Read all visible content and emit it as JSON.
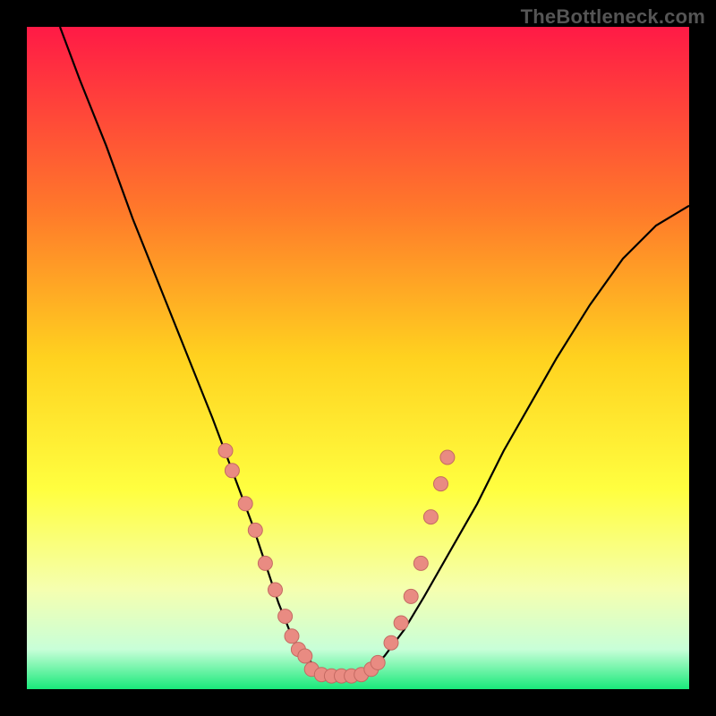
{
  "watermark": "TheBottleneck.com",
  "colors": {
    "bg_black": "#000000",
    "grad_top": "#ff1a46",
    "grad_mid1": "#ff7a2a",
    "grad_mid2": "#ffd21f",
    "grad_mid3": "#ffff40",
    "grad_mid4": "#f5ffb0",
    "grad_bottom_pale": "#c8ffd8",
    "grad_bottom": "#19e97a",
    "curve": "#000000",
    "dot_fill": "#e98b82",
    "dot_stroke": "#c46a62"
  },
  "chart_data": {
    "type": "line",
    "title": "",
    "xlabel": "",
    "ylabel": "",
    "xlim": [
      0,
      100
    ],
    "ylim": [
      0,
      100
    ],
    "series": [
      {
        "name": "curve",
        "x": [
          5,
          8,
          12,
          16,
          20,
          24,
          28,
          31,
          34,
          36,
          38,
          40,
          42,
          44,
          46,
          48,
          50,
          52,
          54,
          57,
          60,
          64,
          68,
          72,
          76,
          80,
          85,
          90,
          95,
          100
        ],
        "y": [
          100,
          92,
          82,
          71,
          61,
          51,
          41,
          33,
          25,
          19,
          13,
          8,
          5,
          3,
          2,
          2,
          2,
          3,
          5,
          9,
          14,
          21,
          28,
          36,
          43,
          50,
          58,
          65,
          70,
          73
        ]
      }
    ],
    "points": [
      {
        "name": "left_cluster",
        "x": [
          30,
          31,
          33,
          34.5,
          36,
          37.5,
          39,
          40,
          41,
          42
        ],
        "y": [
          36,
          33,
          28,
          24,
          19,
          15,
          11,
          8,
          6,
          5
        ]
      },
      {
        "name": "valley",
        "x": [
          43,
          44.5,
          46,
          47.5,
          49,
          50.5,
          52,
          53
        ],
        "y": [
          3,
          2.2,
          2,
          2,
          2,
          2.2,
          3,
          4
        ]
      },
      {
        "name": "right_cluster",
        "x": [
          55,
          56.5,
          58,
          59.5,
          61,
          62.5,
          63.5
        ],
        "y": [
          7,
          10,
          14,
          19,
          26,
          31,
          35
        ]
      }
    ],
    "annotations": [
      {
        "text": "TheBottleneck.com",
        "role": "watermark"
      }
    ]
  }
}
